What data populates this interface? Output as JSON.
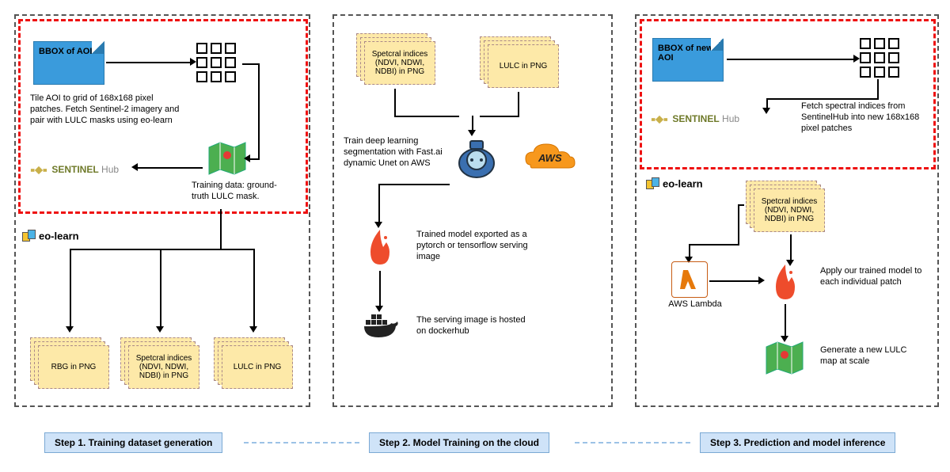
{
  "panel1": {
    "bbox_label": "BBOX of AOI",
    "tile_text": "Tile AOI to grid of 168x168 pixel patches. Fetch Sentinel-2 imagery and pair with LULC masks using eo-learn",
    "training_data": "Training data: ground-truth LULC mask.",
    "rgb": "RBG in PNG",
    "spectral": "Spetcral indices (NDVI, NDWI, NDBI) in PNG",
    "lulc": "LULC in PNG"
  },
  "panel2": {
    "spectral": "Spetcral indices (NDVI, NDWI, NDBI) in PNG",
    "lulc": "LULC in PNG",
    "train_text": "Train deep learning segmentation with Fast.ai dynamic Unet on AWS",
    "exported": "Trained model exported as a pytorch or tensorflow serving image",
    "hosted": "The serving image is hosted on dockerhub"
  },
  "panel3": {
    "bbox_label": "BBOX of  new AOI",
    "fetch_text": "Fetch spectral indices from SentinelHub into new 168x168 pixel patches",
    "spectral": "Spetcral indices (NDVI, NDWI, NDBI) in PNG",
    "lambda": "AWS Lambda",
    "apply": "Apply our trained model to each individual patch",
    "generate": "Generate a new LULC map at scale"
  },
  "brands": {
    "sentinel1": "SENTINEL",
    "sentinel2": " Hub",
    "eolearn": "eo-learn",
    "aws": "AWS"
  },
  "steps": {
    "s1": "Step 1. Training dataset generation",
    "s2": "Step 2. Model Training on the cloud",
    "s3": "Step 3. Prediction and model inference"
  }
}
